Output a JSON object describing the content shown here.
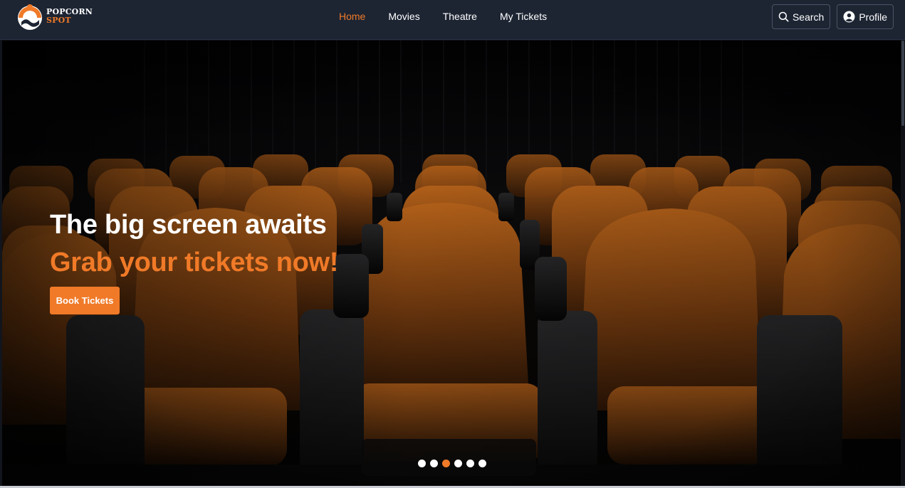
{
  "brand": {
    "line1": "POPCORN",
    "line2": "SPOT"
  },
  "nav": {
    "items": [
      {
        "label": "Home",
        "active": true
      },
      {
        "label": "Movies",
        "active": false
      },
      {
        "label": "Theatre",
        "active": false
      },
      {
        "label": "My Tickets",
        "active": false
      }
    ]
  },
  "actions": {
    "search_label": "Search",
    "search_icon": "search-icon",
    "profile_label": "Profile",
    "profile_icon": "user-circle-icon"
  },
  "hero": {
    "title": "The big screen awaits",
    "subtitle": "Grab your tickets now!",
    "cta_label": "Book Tickets",
    "carousel": {
      "slides": 6,
      "active_index": 2
    }
  },
  "colors": {
    "accent": "#f07a28",
    "header_bg": "#1d2533",
    "seat": "#b8621a"
  }
}
